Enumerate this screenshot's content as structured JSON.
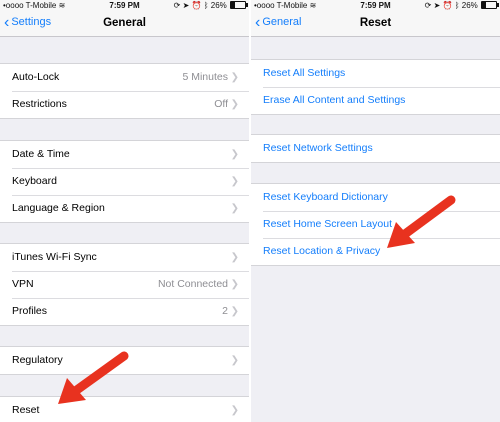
{
  "left": {
    "status": {
      "carrier": "•oooo T-Mobile",
      "time": "7:59 PM",
      "battery": "26%"
    },
    "nav": {
      "back_label": "Settings",
      "title": "General"
    },
    "groups": [
      [
        {
          "label": "Auto-Lock",
          "detail": "5 Minutes"
        },
        {
          "label": "Restrictions",
          "detail": "Off"
        }
      ],
      [
        {
          "label": "Date & Time"
        },
        {
          "label": "Keyboard"
        },
        {
          "label": "Language & Region"
        }
      ],
      [
        {
          "label": "iTunes Wi-Fi Sync"
        },
        {
          "label": "VPN",
          "detail": "Not Connected"
        },
        {
          "label": "Profiles",
          "detail": "2"
        }
      ],
      [
        {
          "label": "Regulatory"
        }
      ],
      [
        {
          "label": "Reset"
        }
      ]
    ]
  },
  "right": {
    "status": {
      "carrier": "•oooo T-Mobile",
      "time": "7:59 PM",
      "battery": "26%"
    },
    "nav": {
      "back_label": "General",
      "title": "Reset"
    },
    "groups": [
      [
        {
          "label": "Reset All Settings"
        },
        {
          "label": "Erase All Content and Settings"
        }
      ],
      [
        {
          "label": "Reset Network Settings"
        }
      ],
      [
        {
          "label": "Reset Keyboard Dictionary"
        },
        {
          "label": "Reset Home Screen Layout"
        },
        {
          "label": "Reset Location & Privacy"
        }
      ]
    ]
  },
  "colors": {
    "accent": "#147efb",
    "background": "#efeff4",
    "annotation_arrow": "#e8321f"
  },
  "icons": [
    "wifi-icon",
    "lock-rotation-icon",
    "location-icon",
    "alarm-icon",
    "bluetooth-icon",
    "battery-icon",
    "chevron-right-icon",
    "chevron-left-icon",
    "red-arrow-annotation"
  ]
}
